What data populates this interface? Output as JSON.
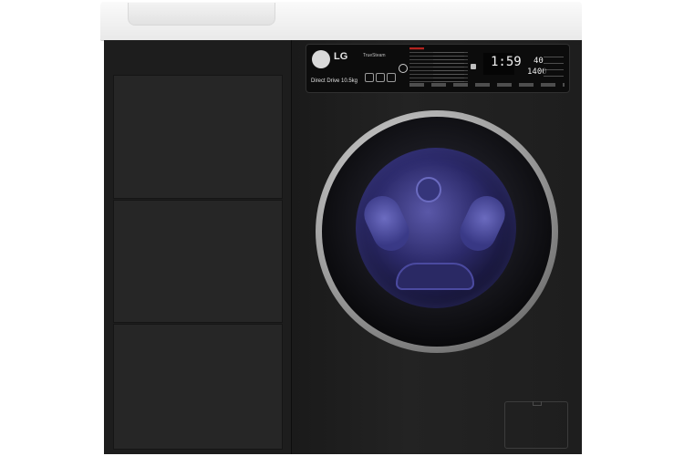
{
  "brand": {
    "logo_text": "LG",
    "steam_label": "TrueSteam",
    "drive_label": "Direct Drive 10.5kg"
  },
  "display": {
    "time": "1:59",
    "temperature": "40",
    "spin": "1400"
  },
  "colors": {
    "cabinet": "#1d1d1d",
    "washer_body": "#1e1e1e",
    "countertop": "#f2f2f2",
    "door_glass": "#2c2a6a",
    "door_ring": "#a8a8a8",
    "panel_accent": "#b3241f"
  }
}
